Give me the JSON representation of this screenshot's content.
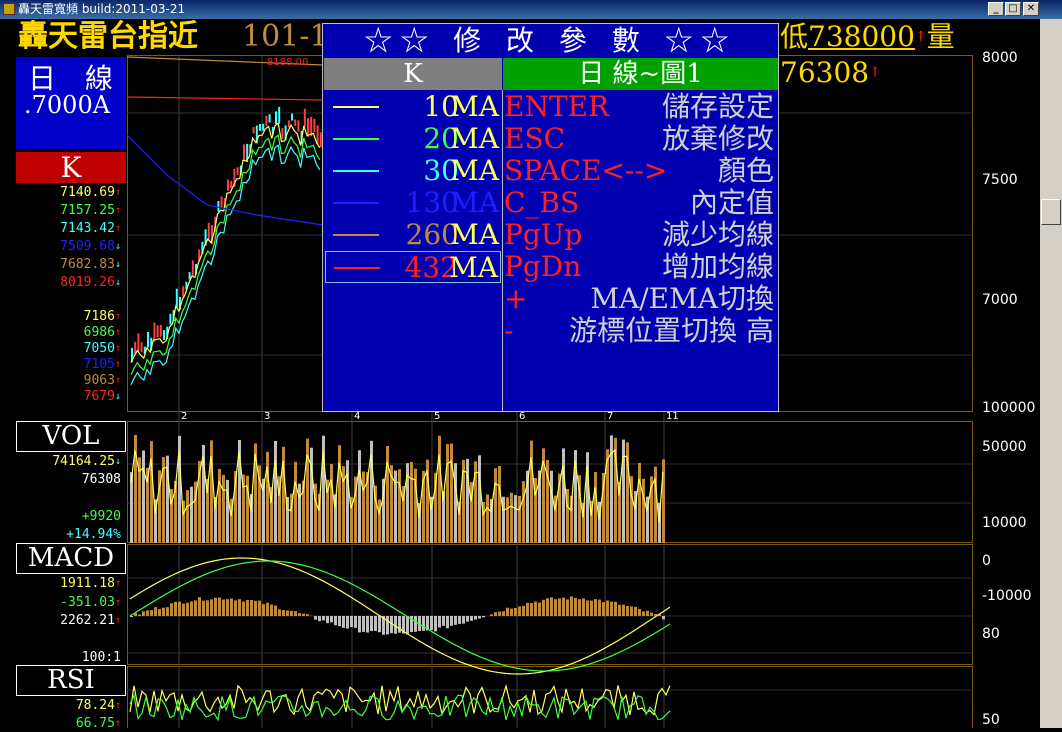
{
  "window": {
    "title": "轟天雷寬頻 build:2011-03-21",
    "min_label": "_",
    "max_label": "□",
    "close_label": "✕"
  },
  "header": {
    "name": "轟天雷台指近",
    "code_text": "101-1",
    "low_prefix": "低",
    "low_value": "738000",
    "vol_prefix": "量",
    "vol_value": "76308",
    "name_color": "#ffd800"
  },
  "sidebar": {
    "period_label": "日 線",
    "period_sub": ".7000A",
    "k_label": "K",
    "ma_values": [
      {
        "text": "7140.69",
        "color": "#ffff60",
        "arrow": "↑"
      },
      {
        "text": "7157.25",
        "color": "#40ff40",
        "arrow": "↑"
      },
      {
        "text": "7143.42",
        "color": "#40ffff",
        "arrow": "↑"
      },
      {
        "text": "7509.68",
        "color": "#2020ff",
        "arrow": "↓"
      },
      {
        "text": "7682.83",
        "color": "#c08a3a",
        "arrow": "↓"
      },
      {
        "text": "8019.26",
        "color": "#ff2020",
        "arrow": "↓"
      }
    ],
    "price_values": [
      {
        "text": "7186",
        "color": "#ffff60",
        "arrow": "↑"
      },
      {
        "text": "6986",
        "color": "#40ff40",
        "arrow": "↑"
      },
      {
        "text": "7050",
        "color": "#40ffff",
        "arrow": "↑"
      },
      {
        "text": "7105",
        "color": "#2020ff",
        "arrow": "↑"
      },
      {
        "text": "9063",
        "color": "#c08a3a",
        "arrow": "↑"
      },
      {
        "text": "7679",
        "color": "#ff2020",
        "arrow": "↓"
      }
    ],
    "vol_label": "VOL",
    "vol_values": [
      {
        "text": "74164.25",
        "color": "#ffff60",
        "arrow": "↓"
      },
      {
        "text": "76308",
        "color": "#ffffff",
        "arrow": ""
      },
      {
        "text": "+9920",
        "color": "#40ff40",
        "arrow": ""
      },
      {
        "text": "+14.94%",
        "color": "#40ffff",
        "arrow": ""
      }
    ],
    "macd_label": "MACD",
    "macd_values": [
      {
        "text": "1911.18",
        "color": "#ffff60",
        "arrow": "↑"
      },
      {
        "text": "-351.03",
        "color": "#40ff40",
        "arrow": "↑"
      },
      {
        "text": "2262.21",
        "color": "#ffffff",
        "arrow": "↑"
      },
      {
        "text": "100:1",
        "color": "#ffffff",
        "arrow": ""
      }
    ],
    "rsi_label": "RSI",
    "rsi_values": [
      {
        "text": "78.24",
        "color": "#ffff60",
        "arrow": "↑"
      },
      {
        "text": "66.75",
        "color": "#40ff40",
        "arrow": "↑"
      }
    ]
  },
  "chart": {
    "price_axis": [
      "8000",
      "7500",
      "7000"
    ],
    "vol_axis": [
      "100000",
      "50000"
    ],
    "macd_axis": [
      "10000",
      "0",
      "-10000"
    ],
    "rsi_axis": [
      "80",
      "50"
    ],
    "month_ticks": [
      "2",
      "3",
      "4",
      "5",
      "6",
      "7",
      "11"
    ],
    "peak_label": "8188.00"
  },
  "dialog": {
    "title": "☆☆ 修 改 參 數 ☆☆",
    "col_k": "K",
    "col_right": "日 線~圖1",
    "ma_rows": [
      {
        "num": "10",
        "ma": "MA",
        "color": "#ffff60"
      },
      {
        "num": "20",
        "ma": "MA",
        "color": "#40ff40"
      },
      {
        "num": "30",
        "ma": "MA",
        "color": "#40ffff"
      },
      {
        "num": "130",
        "ma": "MA",
        "color": "#2020ff"
      },
      {
        "num": "260",
        "ma": "MA",
        "color": "#c08a3a"
      },
      {
        "num": "432",
        "ma": "MA",
        "color": "#ff2020"
      }
    ],
    "keys": [
      {
        "k": "ENTER",
        "d": "儲存設定"
      },
      {
        "k": "ESC",
        "d": "放棄修改"
      },
      {
        "k": "SPACE<-->",
        "d": "顏色"
      },
      {
        "k": "C_BS",
        "d": "內定值"
      },
      {
        "k": "PgUp",
        "d": "減少均線"
      },
      {
        "k": "PgDn",
        "d": "增加均線"
      },
      {
        "k": "+",
        "d": "MA/EMA切換"
      },
      {
        "k": "-",
        "d": "游標位置切換 高"
      }
    ]
  }
}
